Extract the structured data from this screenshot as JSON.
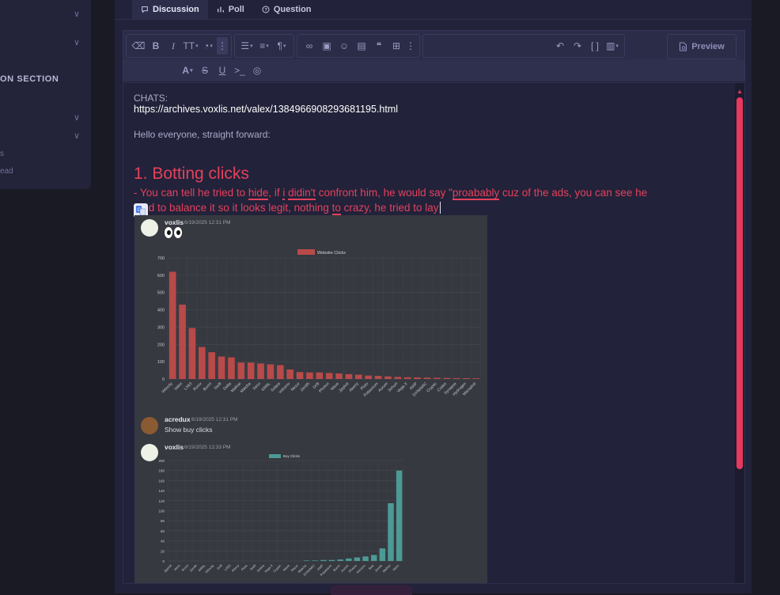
{
  "sidebar": {
    "section_heading": "ON SECTION",
    "fragment_1": "s",
    "fragment_2": "ead"
  },
  "tabs": [
    {
      "label": "Discussion",
      "icon": "chat-icon",
      "active": true
    },
    {
      "label": "Poll",
      "icon": "bar-chart-icon",
      "active": false
    },
    {
      "label": "Question",
      "icon": "question-circle-icon",
      "active": false
    }
  ],
  "toolbar": {
    "preview_label": "Preview"
  },
  "editor": {
    "chats_label": "CHATS:",
    "chats_link": "https://archives.voxlis.net/valex/1384966908293681195.html",
    "hello_line": "Hello everyone, straight forward:",
    "heading": "1. Botting clicks",
    "line1": {
      "p1": "- You can tell he tried to ",
      "w1": "hide",
      "p2": ", if ",
      "w2": "i",
      "p3": " ",
      "w3": "didin't",
      "p4": " confront him, he would say \"",
      "w4": "proabably",
      "p5": " cuz of the ads, you can see he"
    },
    "line2": {
      "p1": "tried to balance it so it looks legit, nothing ",
      "w1": "to",
      "p2": " crazy, he tried to lay"
    }
  },
  "embed": {
    "msg1": {
      "user": "voxlis",
      "time": "6/19/2025 12:31 PM"
    },
    "msg2": {
      "user": "acredux",
      "time": "6/19/2025 12:31 PM",
      "text": "Show buy clicks"
    },
    "msg3": {
      "user": "voxlis",
      "time": "6/19/2025 12:33 PM"
    }
  },
  "chart_data": [
    {
      "type": "bar",
      "legend": "Website Clicks",
      "color": "#b84a4a",
      "ylim": [
        0,
        700
      ],
      "yticks": [
        0,
        100,
        200,
        300,
        400,
        500,
        600,
        700
      ],
      "categories": [
        "Velocity",
        "Valex",
        "LX63",
        "Ronix",
        "Bunni",
        "Swift",
        "Delta",
        "Mallow",
        "Matcha",
        "Xeno",
        "KRNL",
        "Solara",
        "Volcano",
        "Nezur",
        "Zenith",
        "Drift",
        "Photon",
        "Wave",
        "Jjsploit",
        "Akerry",
        "Pluto",
        "Potassium",
        "Aurum",
        "Sirhurt",
        "Vega X",
        "AWP",
        "DYNAMIC",
        "Cryptic",
        "Codex",
        "Synapse",
        "Hydrogen",
        "Macsploit"
      ],
      "values": [
        620,
        430,
        295,
        185,
        155,
        130,
        125,
        95,
        95,
        90,
        85,
        80,
        55,
        40,
        38,
        38,
        35,
        32,
        28,
        25,
        20,
        18,
        15,
        12,
        10,
        9,
        8,
        7,
        6,
        5,
        5,
        4
      ]
    },
    {
      "type": "bar",
      "legend": "Buy Clicks",
      "color": "#4c9a96",
      "ylim": [
        0,
        200
      ],
      "yticks": [
        0,
        20,
        40,
        60,
        80,
        100,
        120,
        140,
        160,
        180,
        200
      ],
      "categories": [
        "Jjsploit",
        "Xeno",
        "Ronix",
        "Zenith",
        "KRNL",
        "Velocity",
        "Drift",
        "LX63",
        "Akerry",
        "Pluto",
        "Swift",
        "Solara",
        "Vega X",
        "Cryptic",
        "Wave",
        "Nezur",
        "Matcha",
        "DYNAMIC",
        "AWP",
        "Potassium",
        "Bunni",
        "Aurum",
        "Photon",
        "Volcano",
        "Swa",
        "Zenite",
        "Mallow",
        "Valex"
      ],
      "values": [
        0,
        0,
        0,
        0,
        0,
        0,
        0,
        0,
        0,
        0,
        0,
        0,
        0,
        0,
        0,
        0,
        1,
        1,
        2,
        2,
        3,
        5,
        7,
        9,
        12,
        25,
        115,
        180
      ]
    }
  ]
}
